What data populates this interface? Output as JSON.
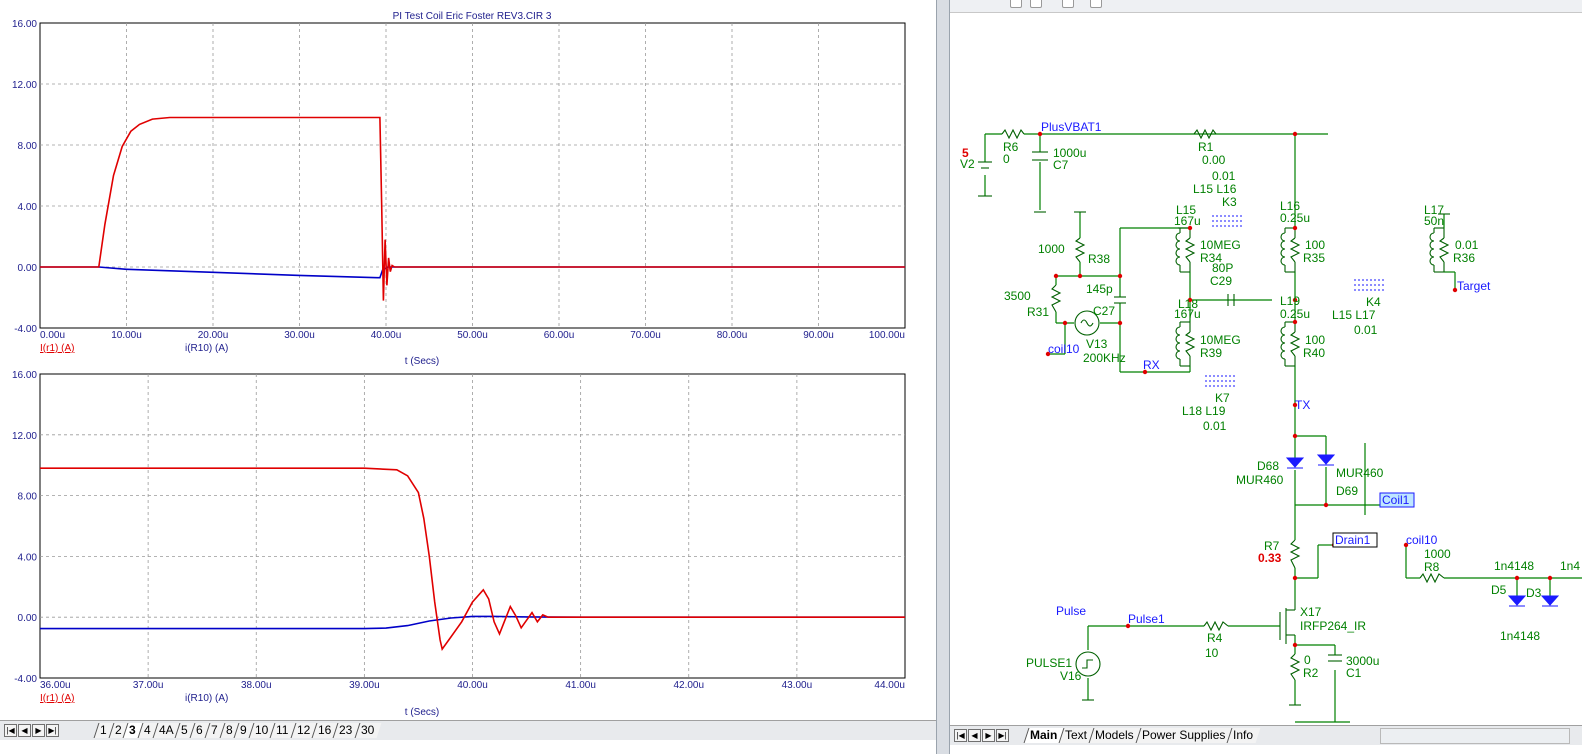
{
  "plot": {
    "title": "PI Test Coil Eric Foster REV3.CIR 3",
    "x_axis_title": "t (Secs)",
    "colors": {
      "r1": "#e00000",
      "r10": "#0000c8",
      "axis_text": "#1d1d8c",
      "grid": "#9a9a9a"
    }
  },
  "chart_data": [
    {
      "type": "line",
      "xlabel": "t (Secs)",
      "ylabel": "",
      "xlim": [
        0,
        100
      ],
      "ylim": [
        -4,
        16
      ],
      "x_ticks": [
        "0.00u",
        "10.00u",
        "20.00u",
        "30.00u",
        "40.00u",
        "50.00u",
        "60.00u",
        "70.00u",
        "80.00u",
        "90.00u",
        "100.00u"
      ],
      "y_ticks": [
        "16.00",
        "12.00",
        "8.00",
        "4.00",
        "0.00",
        "-4.00"
      ],
      "grid": true,
      "legend": [
        "I(r1) (A)",
        "i(R10) (A)"
      ],
      "series": [
        {
          "name": "I(r1) (A)",
          "color": "#e00000",
          "x": [
            0,
            6.8,
            7.5,
            8.5,
            9.5,
            10.5,
            11.5,
            13,
            15,
            17,
            20,
            30,
            38,
            39.3,
            39.5,
            39.7,
            39.9,
            40.1,
            40.3,
            40.5,
            40.7,
            41,
            45,
            100
          ],
          "y": [
            0,
            0,
            2.8,
            6,
            7.9,
            8.9,
            9.35,
            9.7,
            9.8,
            9.8,
            9.8,
            9.8,
            9.8,
            9.8,
            4,
            -2.2,
            1.8,
            -1.2,
            0.6,
            -0.3,
            0.1,
            0,
            0,
            0
          ]
        },
        {
          "name": "i(R10) (A)",
          "color": "#0000c8",
          "x": [
            0,
            6.8,
            10,
            20,
            30,
            39,
            39.3,
            39.6,
            40.2,
            41,
            100
          ],
          "y": [
            0,
            0,
            -0.15,
            -0.35,
            -0.55,
            -0.7,
            -0.7,
            -0.2,
            0,
            0,
            0
          ]
        }
      ]
    },
    {
      "type": "line",
      "xlabel": "t (Secs)",
      "ylabel": "",
      "xlim": [
        36,
        44
      ],
      "ylim": [
        -4,
        16
      ],
      "x_ticks": [
        "36.00u",
        "37.00u",
        "38.00u",
        "39.00u",
        "40.00u",
        "41.00u",
        "42.00u",
        "43.00u",
        "44.00u"
      ],
      "y_ticks": [
        "16.00",
        "12.00",
        "8.00",
        "4.00",
        "0.00",
        "-4.00"
      ],
      "grid": true,
      "legend": [
        "I(r1) (A)",
        "i(R10) (A)"
      ],
      "series": [
        {
          "name": "I(r1) (A)",
          "color": "#e00000",
          "x": [
            36,
            37,
            38,
            39,
            39.3,
            39.4,
            39.5,
            39.55,
            39.6,
            39.65,
            39.7,
            39.72,
            39.8,
            39.9,
            40,
            40.1,
            40.15,
            40.2,
            40.25,
            40.3,
            40.35,
            40.4,
            40.45,
            40.5,
            40.55,
            40.6,
            40.65,
            40.7,
            40.75,
            41,
            44
          ],
          "y": [
            9.8,
            9.8,
            9.8,
            9.8,
            9.7,
            9.3,
            8.2,
            6.5,
            4,
            1,
            -1.5,
            -2.1,
            -1.3,
            -0.3,
            1,
            1.8,
            1.2,
            -0.3,
            -1.1,
            -0.2,
            0.7,
            0.1,
            -0.7,
            -0.2,
            0.3,
            -0.3,
            0.15,
            0,
            0,
            0,
            0
          ]
        },
        {
          "name": "i(R10) (A)",
          "color": "#0000c8",
          "x": [
            36,
            37,
            38,
            39,
            39.2,
            39.4,
            39.6,
            39.8,
            40,
            40.2,
            40.5,
            41,
            44
          ],
          "y": [
            -0.75,
            -0.75,
            -0.75,
            -0.75,
            -0.72,
            -0.55,
            -0.25,
            -0.05,
            0.05,
            0.05,
            0.02,
            0,
            0
          ]
        }
      ]
    }
  ],
  "plot_tabs": {
    "items": [
      "1",
      "2",
      "3",
      "4",
      "4A",
      "5",
      "6",
      "7",
      "8",
      "9",
      "10",
      "11",
      "12",
      "16",
      "23",
      "30"
    ],
    "active": "3"
  },
  "schematic": {
    "labels": {
      "plusvbat": "PlusVBAT1",
      "v2_value": "5",
      "v2": "V2",
      "r6": "R6",
      "r6_value": "0",
      "c7_value": "1000u",
      "c7": "C7",
      "r1": "R1",
      "r1_value": "0.00",
      "k3_value": "0.01",
      "k3_pair": "L15 L16",
      "k3": "K3",
      "l15": "L15",
      "l15_value": "167u",
      "r34_value": "10MEG",
      "r34": "R34",
      "l16": "L16",
      "l16_value": "0.25u",
      "r35_value": "100",
      "r35": "R35",
      "l17": "L17",
      "l17_value": "50n",
      "r36_value": "0.01",
      "r36": "R36",
      "target": "Target",
      "r38_value": "1000",
      "r38": "R38",
      "r31_value": "3500",
      "r31": "R31",
      "c27_value": "145p",
      "c27": "C27",
      "v13": "V13",
      "v13_freq": "200KHz",
      "coil10": "coil10",
      "c29_value": "80P",
      "c29": "C29",
      "l18": "L18",
      "l18_value": "167u",
      "r39_value": "10MEG",
      "r39": "R39",
      "l19": "L19",
      "l19_value": "0.25u",
      "r40_value": "100",
      "r40": "R40",
      "k4": "K4",
      "k4_pair": "L15 L17",
      "k4_value": "0.01",
      "rx": "RX",
      "k7": "K7",
      "k7_pair": "L18 L19",
      "k7_value": "0.01",
      "tx": "TX",
      "d68": "D68",
      "d68_model": "MUR460",
      "d69_model": "MUR460",
      "d69": "D69",
      "coil1": "Coil1",
      "r7": "R7",
      "r7_value": "0.33",
      "drain1": "Drain1",
      "coil10_b": "coil10",
      "r8_value": "1000",
      "r8": "R8",
      "d5_model_top": "1n4148",
      "d5": "D5",
      "d3": "D3",
      "d_model_cut": "1n4",
      "d5_model_bottom": "1n4148",
      "pulse": "Pulse",
      "pulse1": "Pulse1",
      "r4": "R4",
      "r4_value": "10",
      "x17": "X17",
      "x17_model": "IRFP264_IR",
      "pulse1_src": "PULSE1",
      "v16": "V16",
      "r2_value": "0",
      "r2": "R2",
      "c1_value": "3000u",
      "c1": "C1"
    },
    "colors": {
      "wire": "#008000",
      "comp": "#006000",
      "text": "#008000",
      "node_label": "#1a1aff",
      "value_red": "#e00000",
      "diode": "#1a1aff",
      "dot": "#e00000"
    }
  },
  "schem_tabs": {
    "items": [
      "Main",
      "Text",
      "Models",
      "Power Supplies",
      "Info"
    ],
    "active": "Main"
  }
}
